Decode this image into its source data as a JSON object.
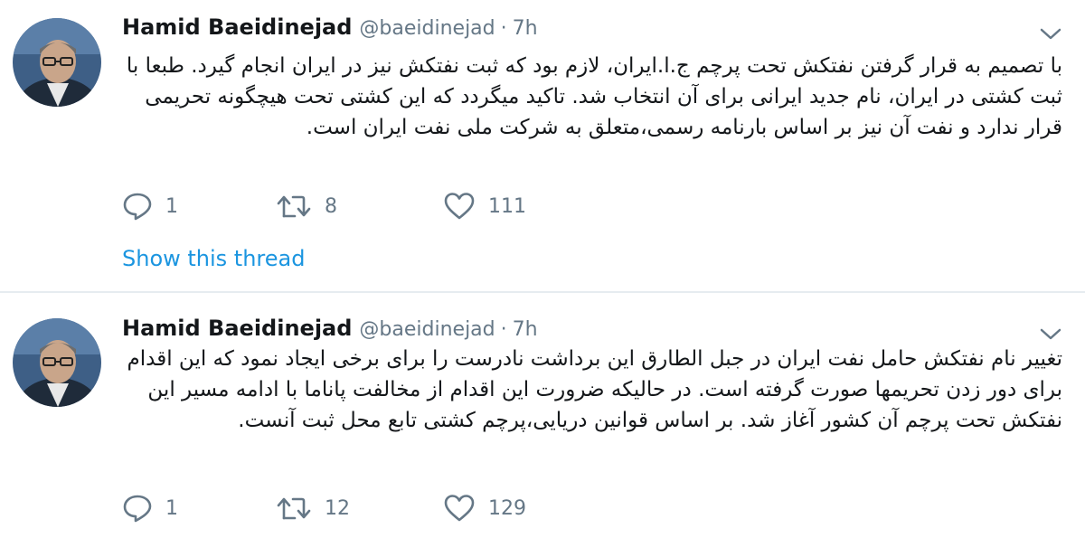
{
  "tweets": [
    {
      "author_name": "Hamid Baeidinejad",
      "handle": "@baeidinejad",
      "separator": "·",
      "time": "7h",
      "text": "با تصمیم به قرار گرفتن نفتکش تحت پرچم ج.ا.ایران، لازم بود که ثبت نفتکش نیز در ایران انجام گیرد. طبعا با ثبت کشتی در ایران، نام جدید ایرانی برای آن انتخاب شد. تاکید میگردد که این کشتی تحت هیچگونه تحریمی قرار ندارد و نفت آن نیز بر اساس بارنامه رسمی،متعلق به شرکت ملی نفت ایران است.",
      "replies": "1",
      "retweets": "8",
      "likes": "111",
      "show_thread": "Show this thread"
    },
    {
      "author_name": "Hamid Baeidinejad",
      "handle": "@baeidinejad",
      "separator": "·",
      "time": "7h",
      "text": "تغییر نام نفتکش حامل نفت ایران در جبل الطارق این برداشت نادرست را برای برخی ایجاد نمود که این اقدام برای دور زدن تحریمها صورت گرفته است. در حالیکه ضرورت این اقدام از مخالفت پاناما با ادامه مسیر این نفتکش تحت پرچم آن کشور آغاز شد. بر اساس قوانین دریایی،پرچم کشتی تابع محل ثبت آنست.",
      "replies": "1",
      "retweets": "12",
      "likes": "129"
    }
  ],
  "colors": {
    "text": "#14171a",
    "secondary": "#657786",
    "link": "#1b95e0",
    "divider": "#e6ecf0"
  },
  "icons": {
    "reply": "reply-icon",
    "retweet": "retweet-icon",
    "like": "heart-icon",
    "more": "chevron-down-icon"
  }
}
